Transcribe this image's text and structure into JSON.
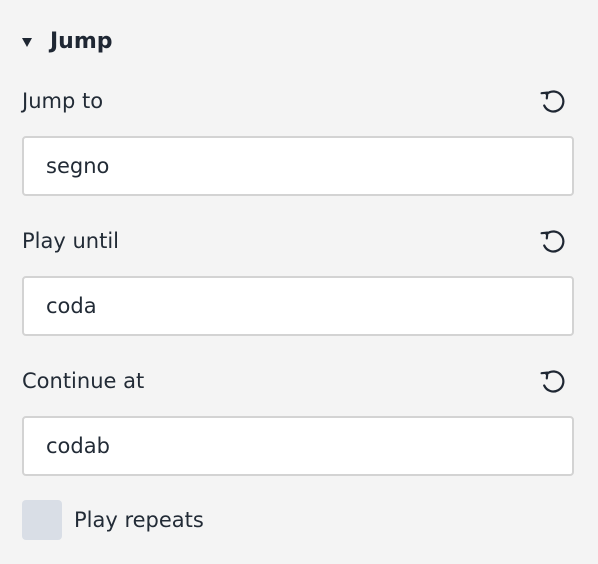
{
  "section": {
    "title": "Jump",
    "expanded": true
  },
  "fields": [
    {
      "label": "Jump to",
      "value": "segno"
    },
    {
      "label": "Play until",
      "value": "coda"
    },
    {
      "label": "Continue at",
      "value": "codab"
    }
  ],
  "checkbox": {
    "label": "Play repeats",
    "checked": false
  },
  "icons": {
    "collapse": "caret-down-icon",
    "reset": "reset-icon"
  },
  "colors": {
    "background": "#f4f4f4",
    "text": "#222b36",
    "input_border": "#d3d3d3",
    "checkbox_fill": "#d9dee6"
  }
}
